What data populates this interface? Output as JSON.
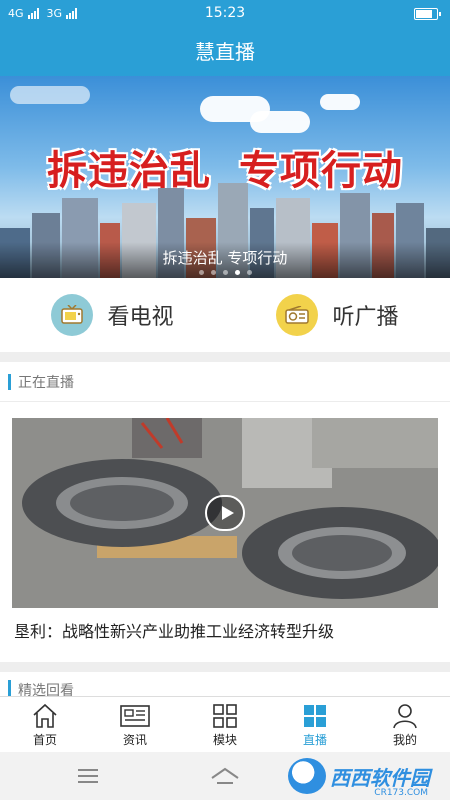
{
  "status_bar": {
    "network1": "4G",
    "network2": "3G",
    "time": "15:23"
  },
  "header": {
    "title": "慧直播"
  },
  "banner": {
    "headline_left": "拆违治乱",
    "headline_right": "专项行动",
    "caption": "拆违治乱 专项行动",
    "dots_total": 5,
    "dots_active_index": 3
  },
  "quick_entries": [
    {
      "label": "看电视",
      "icon": "tv-icon",
      "color": "#8ecad6"
    },
    {
      "label": "听广播",
      "icon": "radio-icon",
      "color": "#f2d24b"
    }
  ],
  "live_section": {
    "title": "正在直播",
    "video_title": "垦利：战略性新兴产业助推工业经济转型升级"
  },
  "replay_section": {
    "title": "精选回看"
  },
  "bottom_nav": [
    {
      "label": "首页",
      "icon": "home-icon"
    },
    {
      "label": "资讯",
      "icon": "news-icon"
    },
    {
      "label": "模块",
      "icon": "modules-icon"
    },
    {
      "label": "直播",
      "icon": "live-icon",
      "active": true
    },
    {
      "label": "我的",
      "icon": "profile-icon"
    }
  ],
  "watermark": {
    "text": "西西软件园",
    "sub": "CR173.COM"
  },
  "colors": {
    "accent": "#2a9fd6",
    "headline": "#d71f1f"
  }
}
